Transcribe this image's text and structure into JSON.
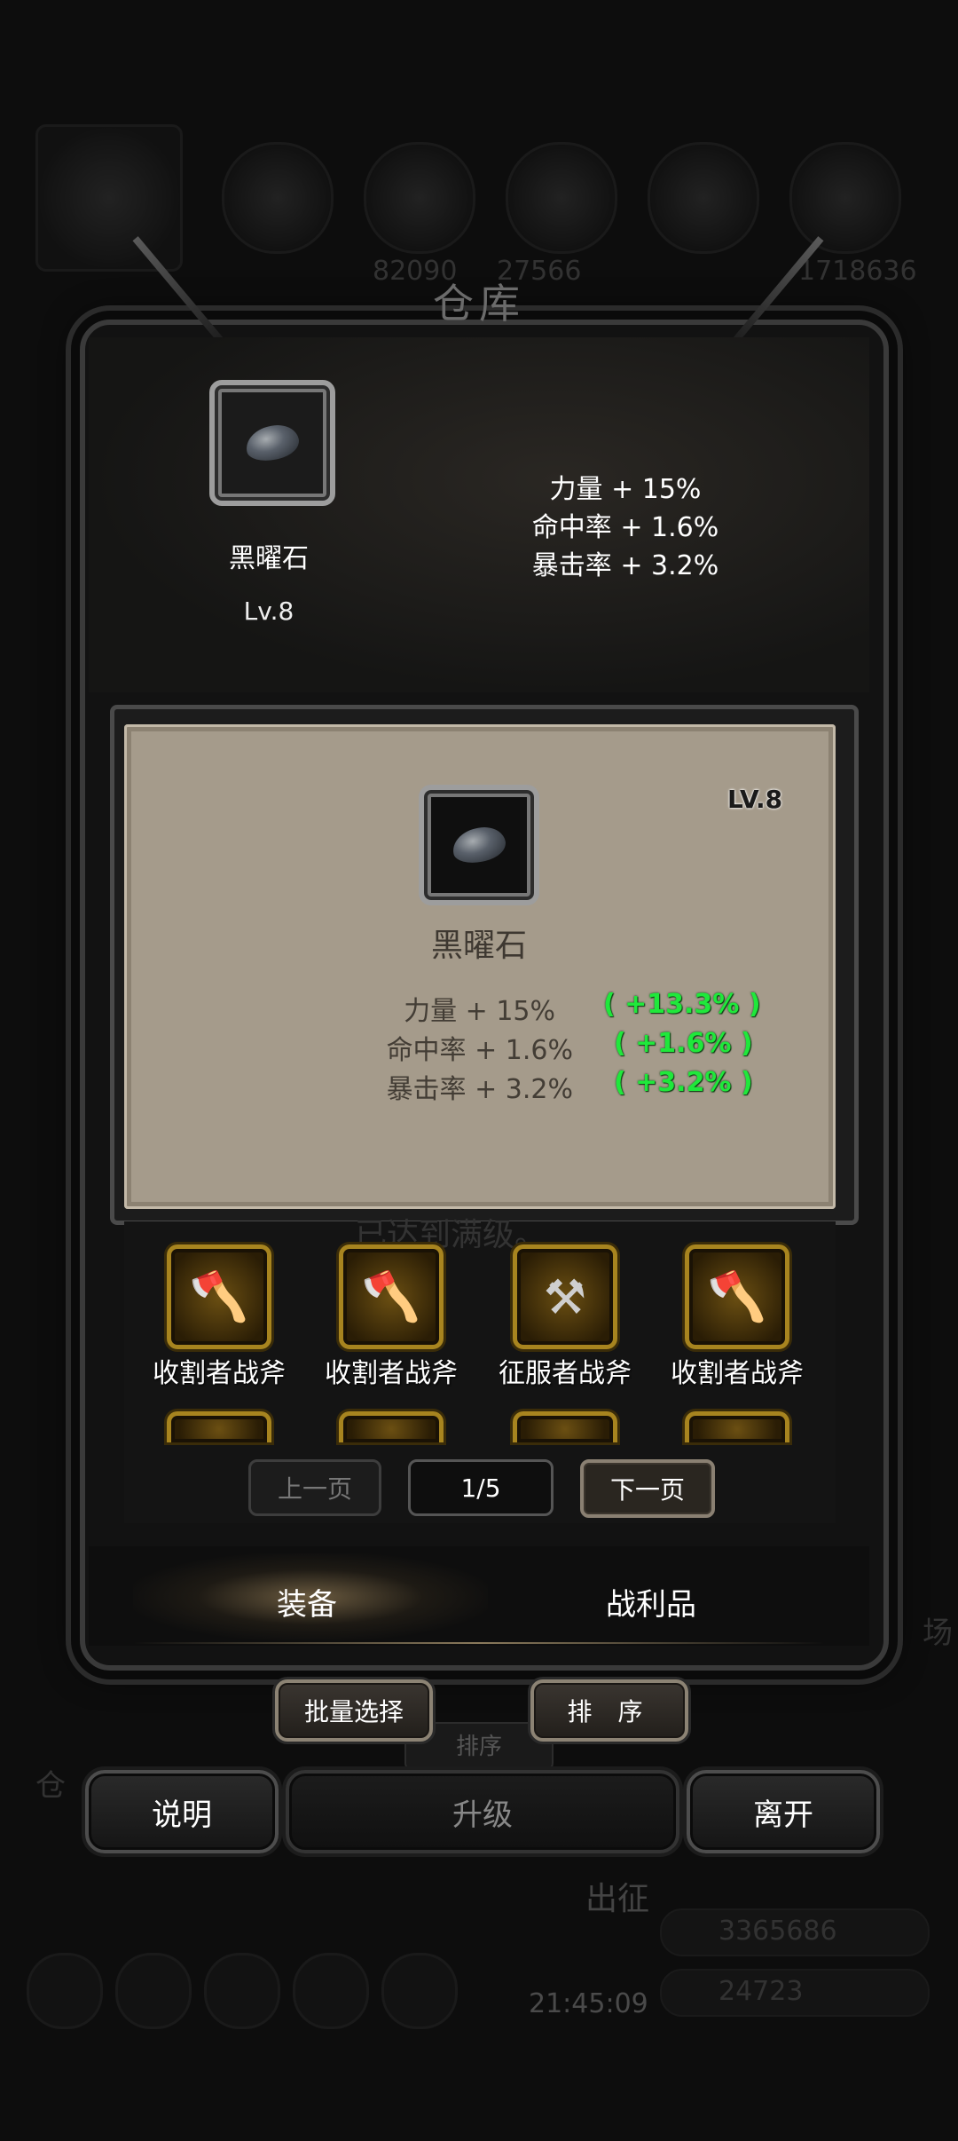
{
  "background": {
    "numbers_left": "82090",
    "numbers_mid": "27566",
    "numbers_right": "1718636",
    "faded_title": "仓",
    "faded_header": "出征",
    "gold_amount": "3365686",
    "gem_amount": "24723",
    "timer": "21:45:09",
    "edge_text_left": "仓",
    "edge_text_right": "场"
  },
  "panel": {
    "title": "仓库"
  },
  "selected_item": {
    "name": "黑曜石",
    "level": "Lv.8",
    "icon": "obsidian-stone-icon",
    "stats": [
      "力量 + 15%",
      "命中率 + 1.6%",
      "暴击率 + 3.2%"
    ]
  },
  "detail_card": {
    "level": "LV.8",
    "name": "黑曜石",
    "icon": "obsidian-stone-icon",
    "stats": [
      {
        "label": "力量 + 15%",
        "bonus": "( +13.3% )"
      },
      {
        "label": "命中率 + 1.6%",
        "bonus": "( +1.6% )"
      },
      {
        "label": "暴击率 + 3.2%",
        "bonus": "( +3.2% )"
      }
    ],
    "bonus_color": "#1fe83b",
    "faded_message": "已达到满级。"
  },
  "inventory": {
    "items": [
      {
        "name": "收割者战斧",
        "icon": "axe-icon"
      },
      {
        "name": "收割者战斧",
        "icon": "axe-icon"
      },
      {
        "name": "征服者战斧",
        "icon": "battle-axe-icon"
      },
      {
        "name": "收割者战斧",
        "icon": "axe-icon"
      }
    ],
    "pagination": {
      "prev": "上一页",
      "current": "1/5",
      "next": "下一页"
    }
  },
  "tabs": [
    {
      "label": "装备",
      "active": true
    },
    {
      "label": "战利品",
      "active": false
    }
  ],
  "actions": {
    "batch_select": "批量选择",
    "sort": "排 序",
    "ghost_sort": "排序",
    "help": "说明",
    "upgrade": "升级",
    "leave": "离开"
  },
  "colors": {
    "card_bg": "#a59b8b",
    "gold_border": "#a7841f",
    "panel_bg": "#121212"
  }
}
